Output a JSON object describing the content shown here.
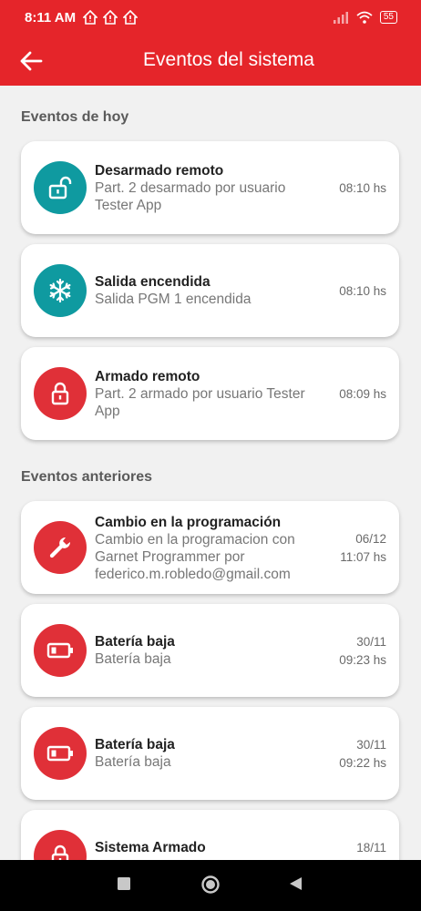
{
  "status_bar": {
    "time": "8:11 AM",
    "notifications": [
      "home-alert-icon",
      "home-alert-icon",
      "home-alert-icon"
    ],
    "battery": "55"
  },
  "header": {
    "title": "Eventos del sistema"
  },
  "sections": {
    "today": "Eventos de hoy",
    "previous": "Eventos anteriores"
  },
  "events_today": [
    {
      "icon": "unlock-icon",
      "color": "#0f9aa0",
      "title": "Desarmado remoto",
      "desc": "Part. 2 desarmado por usuario Tester App",
      "date": "",
      "time": "08:10 hs"
    },
    {
      "icon": "snowflake-icon",
      "color": "#0f9aa0",
      "title": "Salida encendida",
      "desc": "Salida PGM 1 encendida",
      "date": "",
      "time": "08:10 hs"
    },
    {
      "icon": "lock-icon",
      "color": "#e03038",
      "title": "Armado remoto",
      "desc": "Part. 2 armado por usuario Tester App",
      "date": "",
      "time": "08:09 hs"
    }
  ],
  "events_previous": [
    {
      "icon": "wrench-icon",
      "color": "#e03038",
      "title": "Cambio en la programación",
      "desc": "Cambio en la programacion con Garnet Programmer por federico.m.robledo@gmail.com",
      "date": "06/12",
      "time": "11:07 hs"
    },
    {
      "icon": "battery-low-icon",
      "color": "#e03038",
      "title": "Batería baja",
      "desc": "Batería baja",
      "date": "30/11",
      "time": "09:23 hs"
    },
    {
      "icon": "battery-low-icon",
      "color": "#e03038",
      "title": "Batería baja",
      "desc": "Batería baja",
      "date": "30/11",
      "time": "09:22 hs"
    },
    {
      "icon": "lock-icon",
      "color": "#e03038",
      "title": "Sistema Armado",
      "desc": "",
      "date": "18/11",
      "time": ""
    }
  ],
  "colors": {
    "primary": "#e5252a",
    "teal": "#0f9aa0",
    "alert_red": "#e03038"
  }
}
